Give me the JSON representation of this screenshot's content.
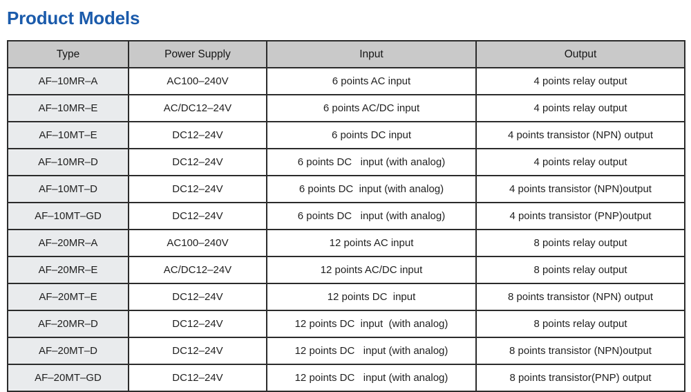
{
  "title": "Product Models",
  "accent_color": "#1b5bab",
  "table": {
    "header_bg": "#c9c9c9",
    "type_col_bg": "#e9ebed",
    "border_color": "#2b2b2b",
    "columns": [
      "Type",
      "Power Supply",
      "Input",
      "Output"
    ],
    "rows": [
      {
        "type": "AF–10MR–A",
        "power": "AC100–240V",
        "input": "6 points AC input",
        "output": "4 points relay output"
      },
      {
        "type": "AF–10MR–E",
        "power": "AC/DC12–24V",
        "input": "6 points AC/DC input",
        "output": "4 points relay output"
      },
      {
        "type": "AF–10MT–E",
        "power": "DC12–24V",
        "input": "6 points DC input",
        "output": "4 points transistor (NPN) output"
      },
      {
        "type": "AF–10MR–D",
        "power": "DC12–24V",
        "input": "6 points DC   input (with analog)",
        "output": "4 points relay output"
      },
      {
        "type": "AF–10MT–D",
        "power": "DC12–24V",
        "input": "6 points DC  input (with analog)",
        "output": "4 points transistor (NPN)output"
      },
      {
        "type": "AF–10MT–GD",
        "power": "DC12–24V",
        "input": "6 points DC   input (with analog)",
        "output": "4 points transistor (PNP)output"
      },
      {
        "type": "AF–20MR–A",
        "power": "AC100–240V",
        "input": "12 points AC input",
        "output": "8 points relay output"
      },
      {
        "type": "AF–20MR–E",
        "power": "AC/DC12–24V",
        "input": "12 points AC/DC input",
        "output": "8 points relay output"
      },
      {
        "type": "AF–20MT–E",
        "power": "DC12–24V",
        "input": "12 points DC  input",
        "output": "8 points transistor (NPN) output"
      },
      {
        "type": "AF–20MR–D",
        "power": "DC12–24V",
        "input": "12 points DC  input  (with analog)",
        "output": "8 points relay output"
      },
      {
        "type": "AF–20MT–D",
        "power": "DC12–24V",
        "input": "12 points DC   input (with analog)",
        "output": "8 points transistor (NPN)output"
      },
      {
        "type": "AF–20MT–GD",
        "power": "DC12–24V",
        "input": "12 points DC   input (with analog)",
        "output": "8 points transistor(PNP) output"
      }
    ]
  }
}
